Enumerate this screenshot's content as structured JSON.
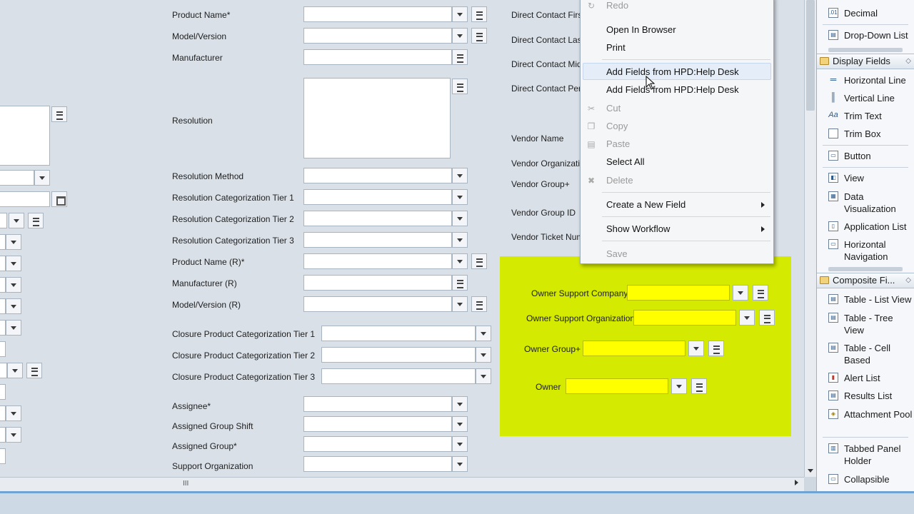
{
  "form": {
    "labels": {
      "product_name": "Product Name*",
      "model_version": "Model/Version",
      "manufacturer": "Manufacturer",
      "resolution": "Resolution",
      "resolution_method": "Resolution Method",
      "res_cat_tier1": "Resolution Categorization Tier 1",
      "res_cat_tier2": "Resolution Categorization Tier 2",
      "res_cat_tier3": "Resolution Categorization Tier 3",
      "product_name_r": "Product Name (R)*",
      "manufacturer_r": "Manufacturer (R)",
      "model_version_r": "Model/Version (R)",
      "closure_tier1": "Closure Product Categorization Tier 1",
      "closure_tier2": "Closure Product Categorization Tier 2",
      "closure_tier3": "Closure Product Categorization Tier 3",
      "assignee": "Assignee*",
      "assigned_group_shift": "Assigned Group Shift",
      "assigned_group": "Assigned Group*",
      "support_organization": "Support Organization",
      "direct_contact_first": "Direct Contact First",
      "direct_contact_last": "Direct Contact Las",
      "direct_contact_middle": "Direct Contact Mid",
      "direct_contact_person": "Direct Contact Per",
      "vendor_name": "Vendor Name",
      "vendor_organization": "Vendor Organizatio",
      "vendor_group": "Vendor Group+",
      "vendor_group_id": "Vendor Group ID",
      "vendor_ticket_number": "Vendor Ticket Num",
      "owner_support_company": "Owner Support Company",
      "owner_support_organization": "Owner Support Organization",
      "owner_group": "Owner Group+",
      "owner": "Owner"
    }
  },
  "context_menu": {
    "redo": "Redo",
    "open_in_browser": "Open In Browser",
    "print": "Print",
    "add_fields_1": "Add Fields from HPD:Help Desk",
    "add_fields_2": "Add Fields from HPD:Help Desk",
    "cut": "Cut",
    "copy": "Copy",
    "paste": "Paste",
    "select_all": "Select All",
    "delete": "Delete",
    "create_new_field": "Create a New Field",
    "show_workflow": "Show Workflow",
    "save": "Save"
  },
  "palette": {
    "decimal": "Decimal",
    "decimal_icon": ".01",
    "dropdown_list": "Drop-Down List",
    "display_fields_header": "Display Fields",
    "horizontal_line": "Horizontal Line",
    "vertical_line": "Vertical Line",
    "trim_text": "Trim Text",
    "trim_text_icon": "Aa",
    "trim_box": "Trim Box",
    "button": "Button",
    "view": "View",
    "data_visualization": "Data Visualization",
    "application_list": "Application List",
    "horizontal_navigation": "Horizontal Navigation",
    "composite_fields_header": "Composite Fi...",
    "table_list_view": "Table - List View",
    "table_tree_view": "Table - Tree View",
    "table_cell_based": "Table - Cell Based",
    "alert_list": "Alert List",
    "results_list": "Results List",
    "attachment_pool": "Attachment Pool",
    "tabbed_panel_holder": "Tabbed Panel Holder",
    "collapsible": "Collapsible"
  },
  "scrollbar": {
    "grip": "III"
  },
  "colors": {
    "highlight_panel": "#d4ea00",
    "highlight_field": "#ffff00",
    "canvas": "#d9e0e8"
  }
}
